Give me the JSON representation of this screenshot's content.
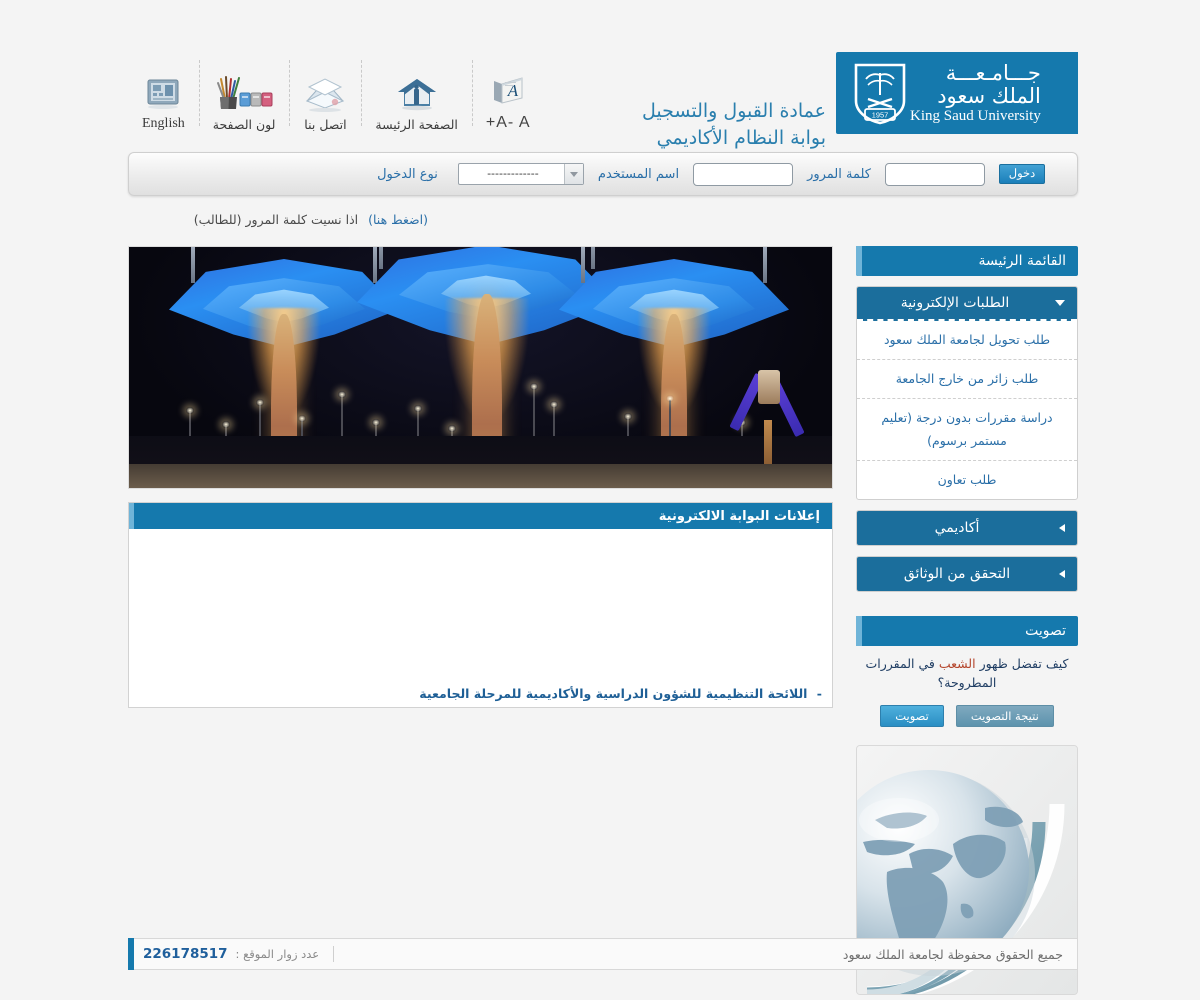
{
  "header": {
    "title_line1": "عمادة القبول والتسجيل",
    "title_line2": "بوابة النظام الأكاديمي",
    "logo": {
      "arabic_line1": "جـــامـعـــة",
      "arabic_line2": "الملك سعود",
      "english": "King Saud University",
      "shield_year": "1957"
    },
    "brand_color": "#1579ad",
    "toolbar": [
      {
        "label": "A-  A+",
        "icon": "font-size-icon",
        "name": "font-size-toggle"
      },
      {
        "label": "الصفحة الرئيسة",
        "icon": "home-icon",
        "name": "home-link"
      },
      {
        "label": "اتصل بنا",
        "icon": "envelope-icon",
        "name": "contact-link"
      },
      {
        "label": "لون الصفحة",
        "icon": "palette-icon",
        "name": "page-color-link"
      },
      {
        "label": "English",
        "icon": "language-icon",
        "name": "english-link"
      }
    ]
  },
  "login": {
    "type_label": "نوع الدخول",
    "type_selected": "-------------",
    "type_options": [
      "-------------"
    ],
    "username_label": "اسم المستخدم",
    "username_value": "",
    "username_placeholder": "",
    "password_label": "كلمة المرور",
    "password_value": "",
    "password_placeholder": "",
    "submit_label": "دخول",
    "forgot_text": "اذا نسيت كلمة المرور (للطالب)",
    "forgot_link": "(اضغط هنا)"
  },
  "main": {
    "hero_alt": "بوابة جامعة الملك سعود ليلاً",
    "announcements_title": "إعلانات البوابة الالكترونية",
    "announcements": [
      {
        "dash": "-",
        "text": "اللائحة التنظيمية للشؤون الدراسية والأكاديمية للمرحلة الجامعية"
      }
    ]
  },
  "sidebar": {
    "main_menu_title": "القائمة الرئيسة",
    "groups": [
      {
        "label": "الطلبات الإلكترونية",
        "expanded": true,
        "caret": "chevron-down-icon",
        "items": [
          "طلب تحويل لجامعة الملك سعود",
          "طلب زائر من خارج الجامعة",
          "دراسة مقررات بدون درجة (تعليم مستمر برسوم)",
          "طلب تعاون"
        ]
      },
      {
        "label": "أكاديمي",
        "expanded": false,
        "caret": "chevron-left-icon",
        "items": []
      },
      {
        "label": "التحقق من الوثائق",
        "expanded": false,
        "caret": "chevron-left-icon",
        "items": []
      }
    ],
    "poll": {
      "title": "تصويت",
      "question_part1": "كيف تفضل ظهور ",
      "question_highlight": "الشعب",
      "question_part2": " في المقررات المطروحة؟",
      "highlight_color": "#b4452b",
      "vote_label": "تصويت",
      "results_label": "نتيجة التصويت"
    },
    "globe_alt": "globe-graphic"
  },
  "footer": {
    "copyright": "جميع الحقوق محفوظة لجامعة الملك سعود",
    "visitors_label": "عدد زوار الموقع :",
    "visitors_count": "226178517"
  }
}
